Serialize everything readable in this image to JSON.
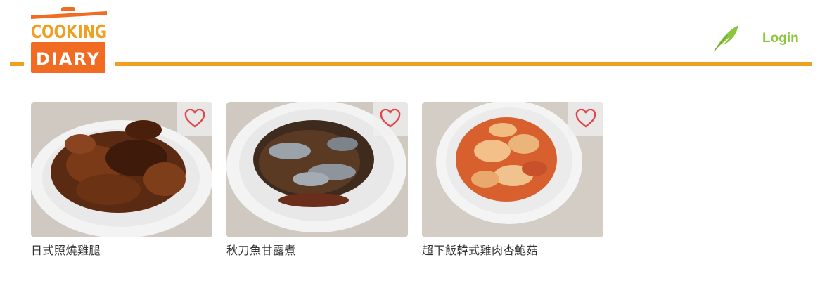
{
  "brand": {
    "logo_line1": "COOKING",
    "logo_line2": "DIARY",
    "accent_color": "#F0A020",
    "logo_orange": "#F26B22"
  },
  "nav": {
    "write_icon": "quill-icon",
    "login_label": "Login",
    "login_color": "#8CC63F"
  },
  "recipes": [
    {
      "title": "日式照燒雞腿",
      "favorite_icon": "heart-outline-icon"
    },
    {
      "title": "秋刀魚甘露煮",
      "favorite_icon": "heart-outline-icon"
    },
    {
      "title": "超下飯韓式雞肉杏鮑菇",
      "favorite_icon": "heart-outline-icon"
    }
  ]
}
